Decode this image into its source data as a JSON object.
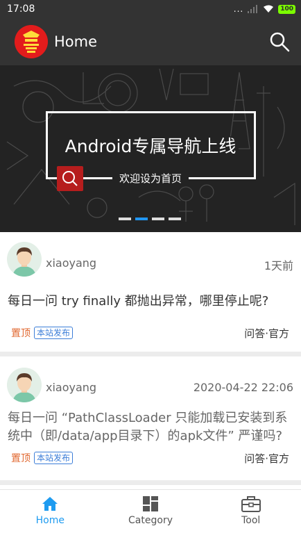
{
  "status_bar": {
    "time": "17:08",
    "signal_text": "...",
    "battery": "100"
  },
  "app_bar": {
    "title": "Home",
    "logo_icon": "app-logo-icon",
    "search_icon": "search-icon"
  },
  "banner": {
    "headline": "Android专属导航上线",
    "subtitle": "欢迎设为首页",
    "indicator_count": 4,
    "active_indicator": 1
  },
  "articles": [
    {
      "author": "xiaoyang",
      "time": "1天前",
      "title": "每日一问 try finally 都抛出异常，哪里停止呢?",
      "tag_top": "置顶",
      "tag_site": "本站发布",
      "category": "问答·官方"
    },
    {
      "author": "xiaoyang",
      "time": "2020-04-22 22:06",
      "title": "每日一问 “PathClassLoader 只能加载已安装到系统中（即/data/app目录下）的apk文件” 严谨吗?",
      "tag_top": "置顶",
      "tag_site": "本站发布",
      "category": "问答·官方"
    }
  ],
  "bottom_nav": {
    "active": "Home",
    "items": [
      {
        "label": "Home",
        "icon": "home-icon"
      },
      {
        "label": "Category",
        "icon": "category-icon"
      },
      {
        "label": "Tool",
        "icon": "toolbox-icon"
      }
    ]
  },
  "colors": {
    "bar_bg": "#333333",
    "accent": "#1e9bf0",
    "tag_top": "#e0672f",
    "tag_site": "#3b7dd8"
  }
}
